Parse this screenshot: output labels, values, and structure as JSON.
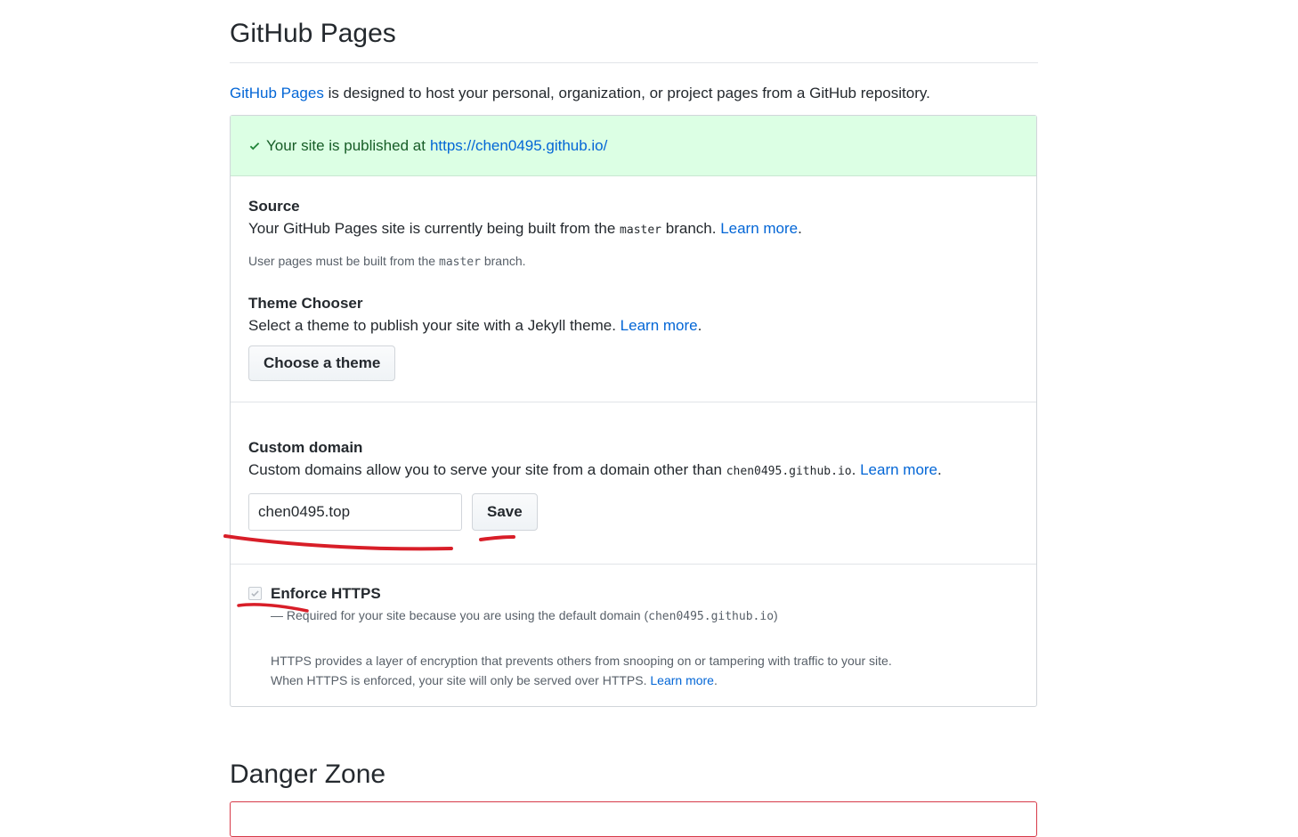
{
  "page": {
    "title": "GitHub Pages",
    "intro_link": "GitHub Pages",
    "intro_text": " is designed to host your personal, organization, or project pages from a GitHub repository."
  },
  "flash": {
    "text": "Your site is published at",
    "url": "https://chen0495.github.io/",
    "color": "#dcffe4"
  },
  "source": {
    "heading": "Source",
    "text_before": "Your GitHub Pages site is currently being built from the",
    "branch": "master",
    "text_after": "branch.",
    "learn_more": "Learn more",
    "period": ".",
    "note_before": "User pages must be built from the",
    "note_branch": "master",
    "note_after": "branch."
  },
  "theme": {
    "heading": "Theme Chooser",
    "text": "Select a theme to publish your site with a Jekyll theme.",
    "learn_more": "Learn more",
    "period": ".",
    "button": "Choose a theme"
  },
  "custom_domain": {
    "heading": "Custom domain",
    "text": "Custom domains allow you to serve your site from a domain other than",
    "domain": "chen0495.github.io",
    "period_after_domain": ".",
    "learn_more": "Learn more",
    "period": ".",
    "input_value": "chen0495.top",
    "save_label": "Save"
  },
  "https": {
    "label": "Enforce HTTPS",
    "checked": true,
    "required_text": "— Required for your site because you are using the default domain (",
    "required_domain": "chen0495.github.io",
    "required_close": ")",
    "desc_line1": "HTTPS provides a layer of encryption that prevents others from snooping on or tampering with traffic to your site.",
    "desc_line2": "When HTTPS is enforced, your site will only be served over HTTPS.",
    "learn_more": "Learn more",
    "period": "."
  },
  "danger": {
    "title": "Danger Zone",
    "border_color": "#d73a49"
  },
  "colors": {
    "link": "#0366d6",
    "annotation": "#d81e28"
  }
}
